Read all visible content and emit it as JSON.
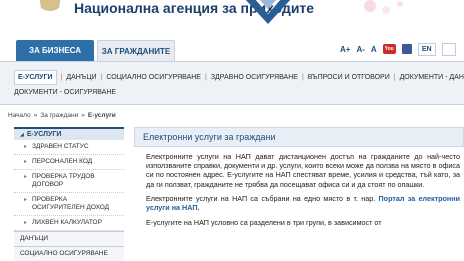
{
  "header": {
    "site_title": "Национална агенция за приходите"
  },
  "tabs": [
    {
      "label": "ЗА БИЗНЕСА"
    },
    {
      "label": "ЗА ГРАЖДАНИТЕ"
    }
  ],
  "tools": {
    "font_increase": "A+",
    "font_decrease": "A-",
    "print": "A",
    "youtube": "You",
    "language": "EN"
  },
  "submenu": {
    "row1": [
      "Е-УСЛУГИ",
      "ДАНЪЦИ",
      "СОЦИАЛНО ОСИГУРЯВАНЕ",
      "ЗДРАВНО ОСИГУРЯВАНЕ",
      "ВЪПРОСИ И ОТГОВОРИ",
      "ДОКУМЕНТИ - ДАН"
    ],
    "row2": [
      "ДОКУМЕНТИ - ОСИГУРЯВАНЕ"
    ]
  },
  "breadcrumb": {
    "home": "Начало",
    "sep1": "»",
    "citizens": "За граждани",
    "sep2": "»",
    "current": "Е-услуги"
  },
  "leftnav": {
    "header": "Е-УСЛУГИ",
    "header_arrow": "◢",
    "items": [
      "ЗДРАВЕН СТАТУС",
      "ПЕРСОНАЛЕН КОД",
      "ПРОВЕРКА ТРУДОВ ДОГОВОР",
      "ПРОВЕРКА ОСИГУРИТЕЛЕН ДОХОД",
      "ЛИХВЕН КАЛКУЛАТОР"
    ],
    "sections": [
      "ДАНЪЦИ",
      "СОЦИАЛНО ОСИГУРЯВАНЕ"
    ]
  },
  "content": {
    "title": "Електронни услуги за граждани",
    "p1": "Електронните услуги на НАП дават дистанционен достъп на гражданите до най-често използваните справки, документи и др. услуги, които всеки може да ползва на място в офиса си по постоянен адрес. Е-услугите на НАП спестяват време, усилия и средства, тъй като, за да ги ползват, гражданите не трябва да посещават офиса си и да стоят по опашки.",
    "p2_text": "Електронните услуги на НАП са събрани на едно място в т. нар.",
    "p2_link": "Портал за електронни услуги на НАП.",
    "p3": "Е-услугите на НАП условно са разделени в три групи, в зависимост от"
  },
  "colors": {
    "primary_blue": "#1e4f7c",
    "tab_active": "#2d6fa8",
    "link": "#1e5fa0"
  }
}
